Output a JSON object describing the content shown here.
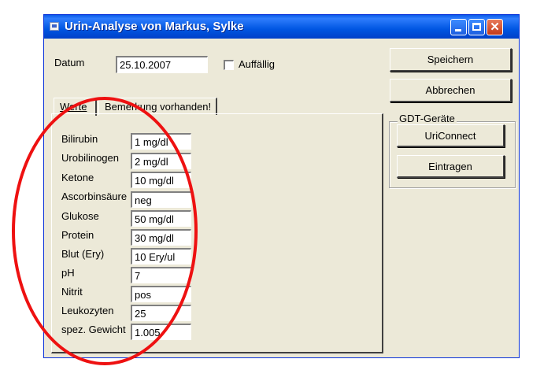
{
  "window": {
    "title": "Urin-Analyse von Markus, Sylke",
    "controls": {
      "minimize": "minimize",
      "maximize": "maximize",
      "close": "close"
    }
  },
  "header": {
    "datum_label": "Datum",
    "datum_value": "25.10.2007",
    "auffaellig_label": "Auffällig",
    "auffaellig_checked": false
  },
  "tabs": [
    {
      "label": "Werte",
      "active": true
    },
    {
      "label": "Bemerkung vorhanden!",
      "active": false
    }
  ],
  "values": [
    {
      "label": "Bilirubin",
      "value": "1 mg/dl"
    },
    {
      "label": "Urobilinogen",
      "value": "2 mg/dl"
    },
    {
      "label": "Ketone",
      "value": "10 mg/dl"
    },
    {
      "label": "Ascorbinsäure",
      "value": "neg"
    },
    {
      "label": "Glukose",
      "value": "50 mg/dl"
    },
    {
      "label": "Protein",
      "value": "30 mg/dl"
    },
    {
      "label": "Blut (Ery)",
      "value": "10 Ery/ul"
    },
    {
      "label": "pH",
      "value": "7"
    },
    {
      "label": "Nitrit",
      "value": "pos"
    },
    {
      "label": "Leukozyten",
      "value": "25"
    },
    {
      "label": "spez. Gewicht",
      "value": "1.005"
    }
  ],
  "buttons": {
    "save": "Speichern",
    "cancel": "Abbrechen"
  },
  "gdt": {
    "group_title": "GDT-Geräte",
    "uriconnect": "UriConnect",
    "eintragen": "Eintragen"
  },
  "annotation": {
    "color": "#ee1111",
    "shape": "oval"
  },
  "colors": {
    "titlebar": "#0056e2",
    "dialog": "#ece9d8"
  }
}
